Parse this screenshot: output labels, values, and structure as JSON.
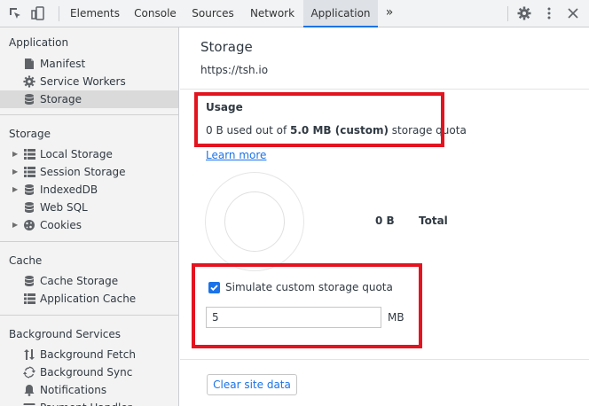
{
  "toolbar": {
    "tabs": [
      {
        "label": "Elements"
      },
      {
        "label": "Console"
      },
      {
        "label": "Sources"
      },
      {
        "label": "Network"
      },
      {
        "label": "Application",
        "active": true
      }
    ],
    "more_tabs_glyph": "»",
    "icons": [
      "inspect-icon",
      "device-toggle-icon",
      "settings-icon",
      "more-vert-icon",
      "close-icon"
    ]
  },
  "sidebar": {
    "sections": [
      {
        "title": "Application",
        "items": [
          {
            "label": "Manifest",
            "icon": "file-icon"
          },
          {
            "label": "Service Workers",
            "icon": "gear-icon"
          },
          {
            "label": "Storage",
            "icon": "database-icon",
            "selected": true
          }
        ]
      },
      {
        "title": "Storage",
        "items": [
          {
            "label": "Local Storage",
            "icon": "grid-icon",
            "expandable": true
          },
          {
            "label": "Session Storage",
            "icon": "grid-icon",
            "expandable": true
          },
          {
            "label": "IndexedDB",
            "icon": "database-icon",
            "expandable": true
          },
          {
            "label": "Web SQL",
            "icon": "database-icon"
          },
          {
            "label": "Cookies",
            "icon": "cookie-icon",
            "expandable": true
          }
        ]
      },
      {
        "title": "Cache",
        "items": [
          {
            "label": "Cache Storage",
            "icon": "database-icon"
          },
          {
            "label": "Application Cache",
            "icon": "grid-icon"
          }
        ]
      },
      {
        "title": "Background Services",
        "items": [
          {
            "label": "Background Fetch",
            "icon": "updown-arrows-icon"
          },
          {
            "label": "Background Sync",
            "icon": "sync-icon"
          },
          {
            "label": "Notifications",
            "icon": "bell-icon"
          },
          {
            "label": "Payment Handler",
            "icon": "card-icon"
          }
        ]
      }
    ]
  },
  "main": {
    "title": "Storage",
    "origin": "https://tsh.io",
    "usage": {
      "heading": "Usage",
      "prefix": "0 B used out of ",
      "quota": "5.0 MB (custom)",
      "suffix": " storage quota",
      "learn_more": "Learn more"
    },
    "chart": {
      "total_value": "0 B",
      "total_label": "Total"
    },
    "simulate": {
      "label": "Simulate custom storage quota",
      "checked": true,
      "input_value": "5",
      "unit": "MB"
    },
    "clear_button": "Clear site data"
  },
  "colors": {
    "accent": "#1a73e8",
    "highlight": "#e3141f",
    "sidebar_bg": "#f3f3f3",
    "toolbar_bg": "#f1f3f4"
  }
}
